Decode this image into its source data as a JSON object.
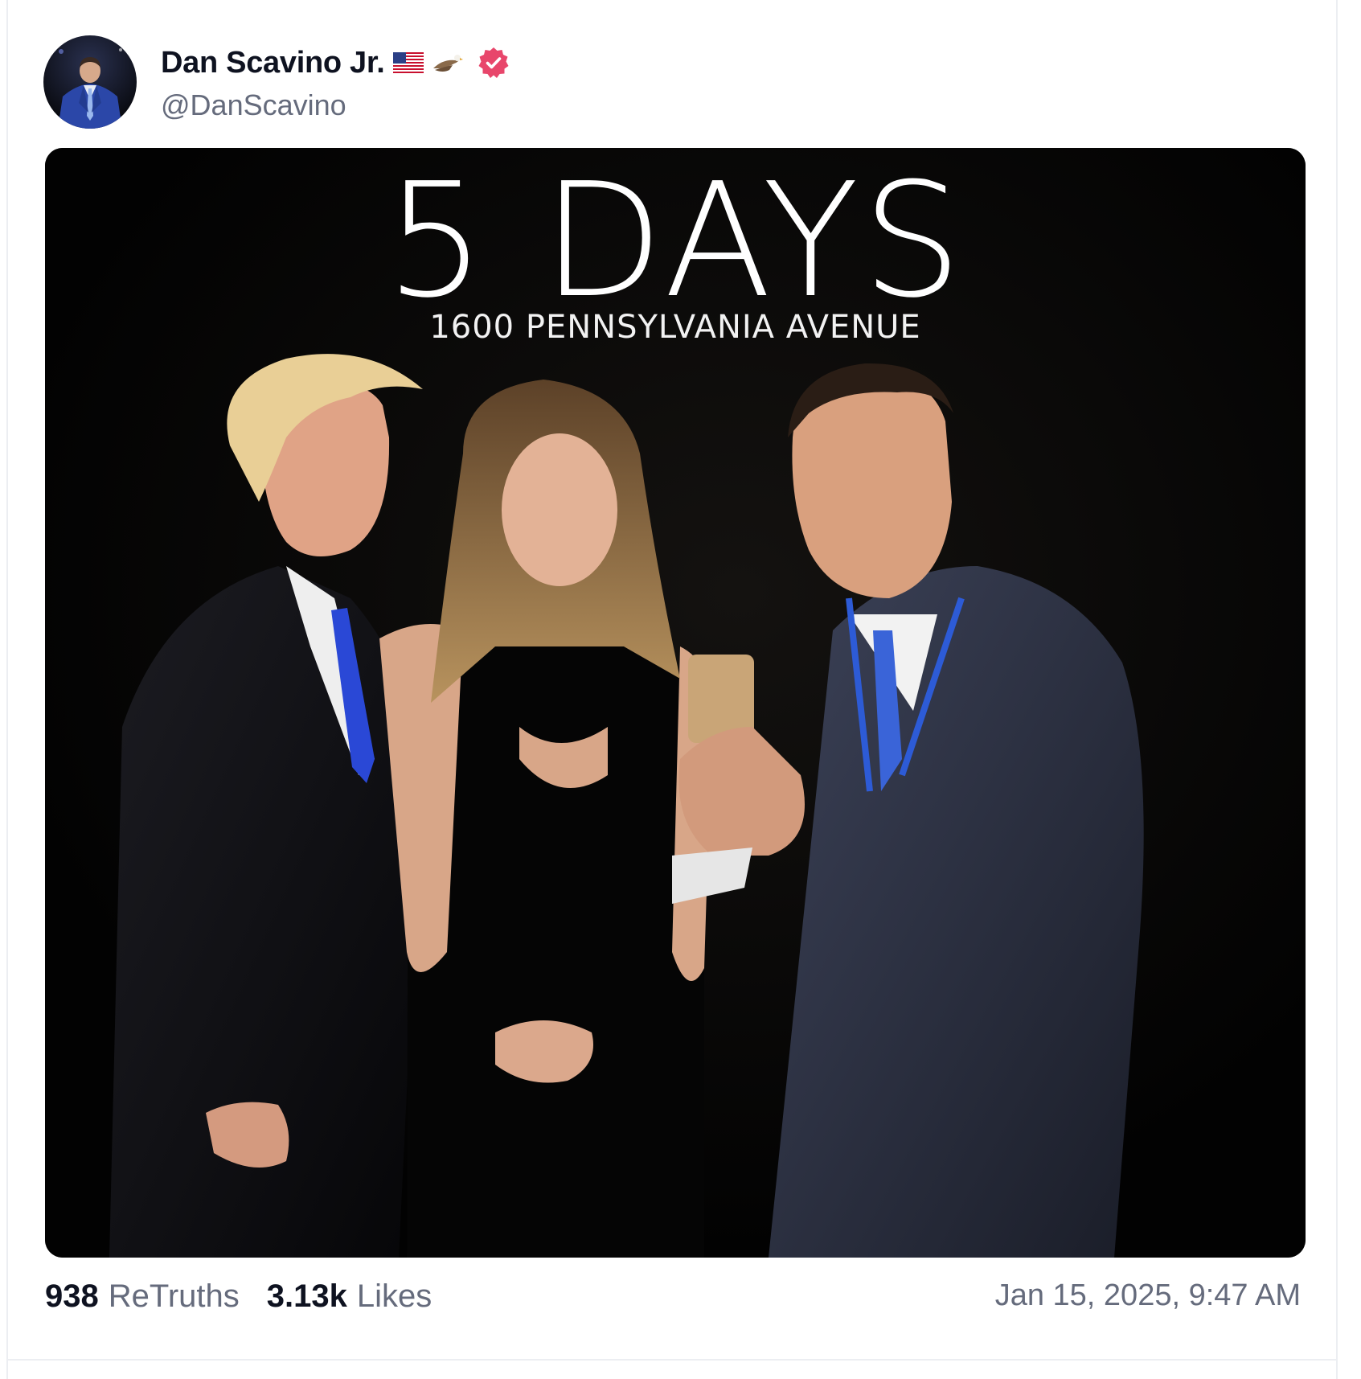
{
  "post": {
    "author": {
      "display_name": "Dan Scavino Jr.",
      "handle": "@DanScavino",
      "emoji": [
        "flag-united-states",
        "eagle"
      ],
      "verified": true,
      "verified_badge_color": "#e8466b",
      "avatar_icon": "avatar-photo"
    },
    "media": {
      "headline": "5 DAYS",
      "subline": "1600 PENNSYLVANIA AVENUE",
      "background_color": "#030303"
    },
    "stats": {
      "retruths_count": "938",
      "retruths_label": "ReTruths",
      "likes_count": "3.13k",
      "likes_label": "Likes"
    },
    "timestamp": "Jan 15, 2025, 9:47 AM"
  },
  "colors": {
    "text_primary": "#0e1220",
    "text_secondary": "#656b7c",
    "divider": "#eceef2"
  }
}
